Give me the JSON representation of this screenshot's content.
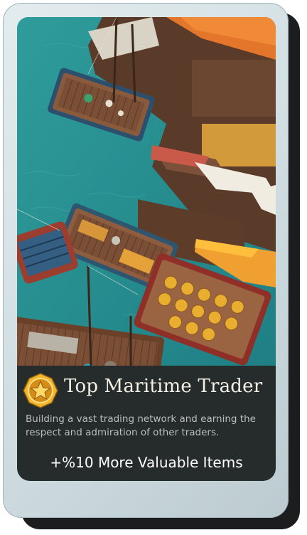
{
  "card": {
    "title": "Top Maritime Trader",
    "description": "Building a vast trading network and earning the respect and admiration of other traders.",
    "bonus": "+%10 More Valuable Items",
    "badge_icon": "star-medal-icon"
  },
  "colors": {
    "water": "#2a8f91",
    "panel": "#262c2c",
    "frame": "#d6e2e5",
    "title": "#f3f0e6",
    "badge_gold": "#e9a723"
  }
}
